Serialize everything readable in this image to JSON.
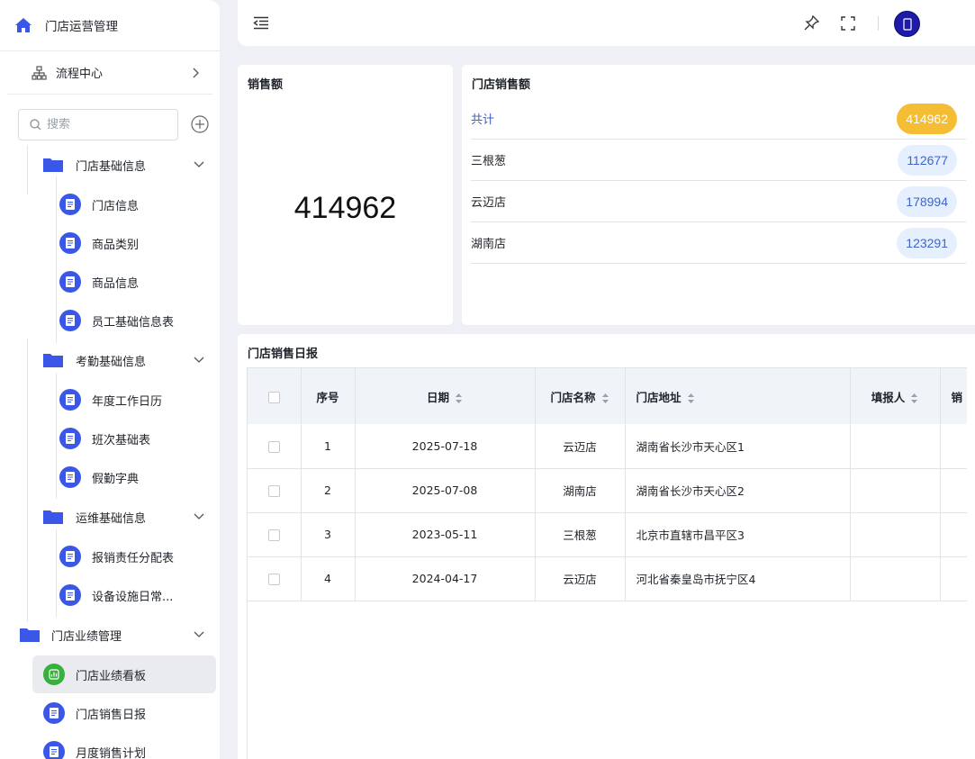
{
  "sidebar": {
    "app_title": "门店运营管理",
    "flow_center": "流程中心",
    "search_placeholder": "搜索",
    "groups": [
      {
        "label": "门店基础信息",
        "items": [
          "门店信息",
          "商品类别",
          "商品信息",
          "员工基础信息表"
        ]
      },
      {
        "label": "考勤基础信息",
        "items": [
          "年度工作日历",
          "班次基础表",
          "假勤字典"
        ]
      },
      {
        "label": "运维基础信息",
        "items": [
          "报销责任分配表",
          "设备设施日常..."
        ]
      }
    ],
    "top_group": {
      "label": "门店业绩管理",
      "items": [
        "门店业绩看板",
        "门店销售日报",
        "月度销售计划"
      ]
    }
  },
  "sales_card": {
    "title": "销售额",
    "value": "414962"
  },
  "store_sales_card": {
    "title": "门店销售额",
    "rows": [
      {
        "name": "共计",
        "value": "414962"
      },
      {
        "name": "三根葱",
        "value": "112677"
      },
      {
        "name": "云迈店",
        "value": "178994"
      },
      {
        "name": "湖南店",
        "value": "123291"
      }
    ]
  },
  "daily_report": {
    "title": "门店销售日报",
    "columns": [
      "序号",
      "日期",
      "门店名称",
      "门店地址",
      "填报人",
      "销"
    ],
    "rows": [
      {
        "no": "1",
        "date": "2025-07-18",
        "store": "云迈店",
        "address": "湖南省长沙市天心区1"
      },
      {
        "no": "2",
        "date": "2025-07-08",
        "store": "湖南店",
        "address": "湖南省长沙市天心区2"
      },
      {
        "no": "3",
        "date": "2023-05-11",
        "store": "三根葱",
        "address": "北京市直辖市昌平区3"
      },
      {
        "no": "4",
        "date": "2024-04-17",
        "store": "云迈店",
        "address": "河北省秦皇岛市抚宁区4"
      }
    ]
  },
  "colors": {
    "accent": "#3b5bdb",
    "folder": "#3b57e8",
    "gold": "#f5bd34",
    "green": "#38b03c"
  }
}
